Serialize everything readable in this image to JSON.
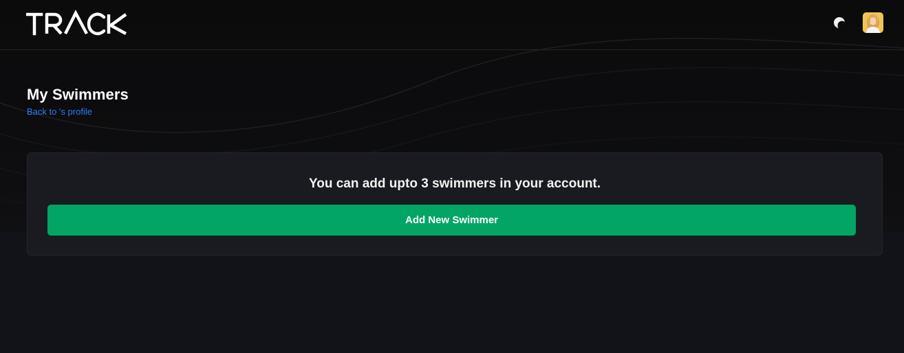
{
  "header": {
    "logo_text": "TRACK",
    "theme_toggle_icon": "moon-icon",
    "avatar_icon": "user-avatar"
  },
  "main": {
    "title": "My Swimmers",
    "back_link": "Back to 's profile"
  },
  "card": {
    "message": "You can add upto 3 swimmers in your account.",
    "button_label": "Add New Swimmer"
  },
  "colors": {
    "background": "#121318",
    "hero": "#0b0b0c",
    "card": "#1a1b20",
    "accent_green": "#03a564",
    "link_blue": "#2f7df6"
  }
}
